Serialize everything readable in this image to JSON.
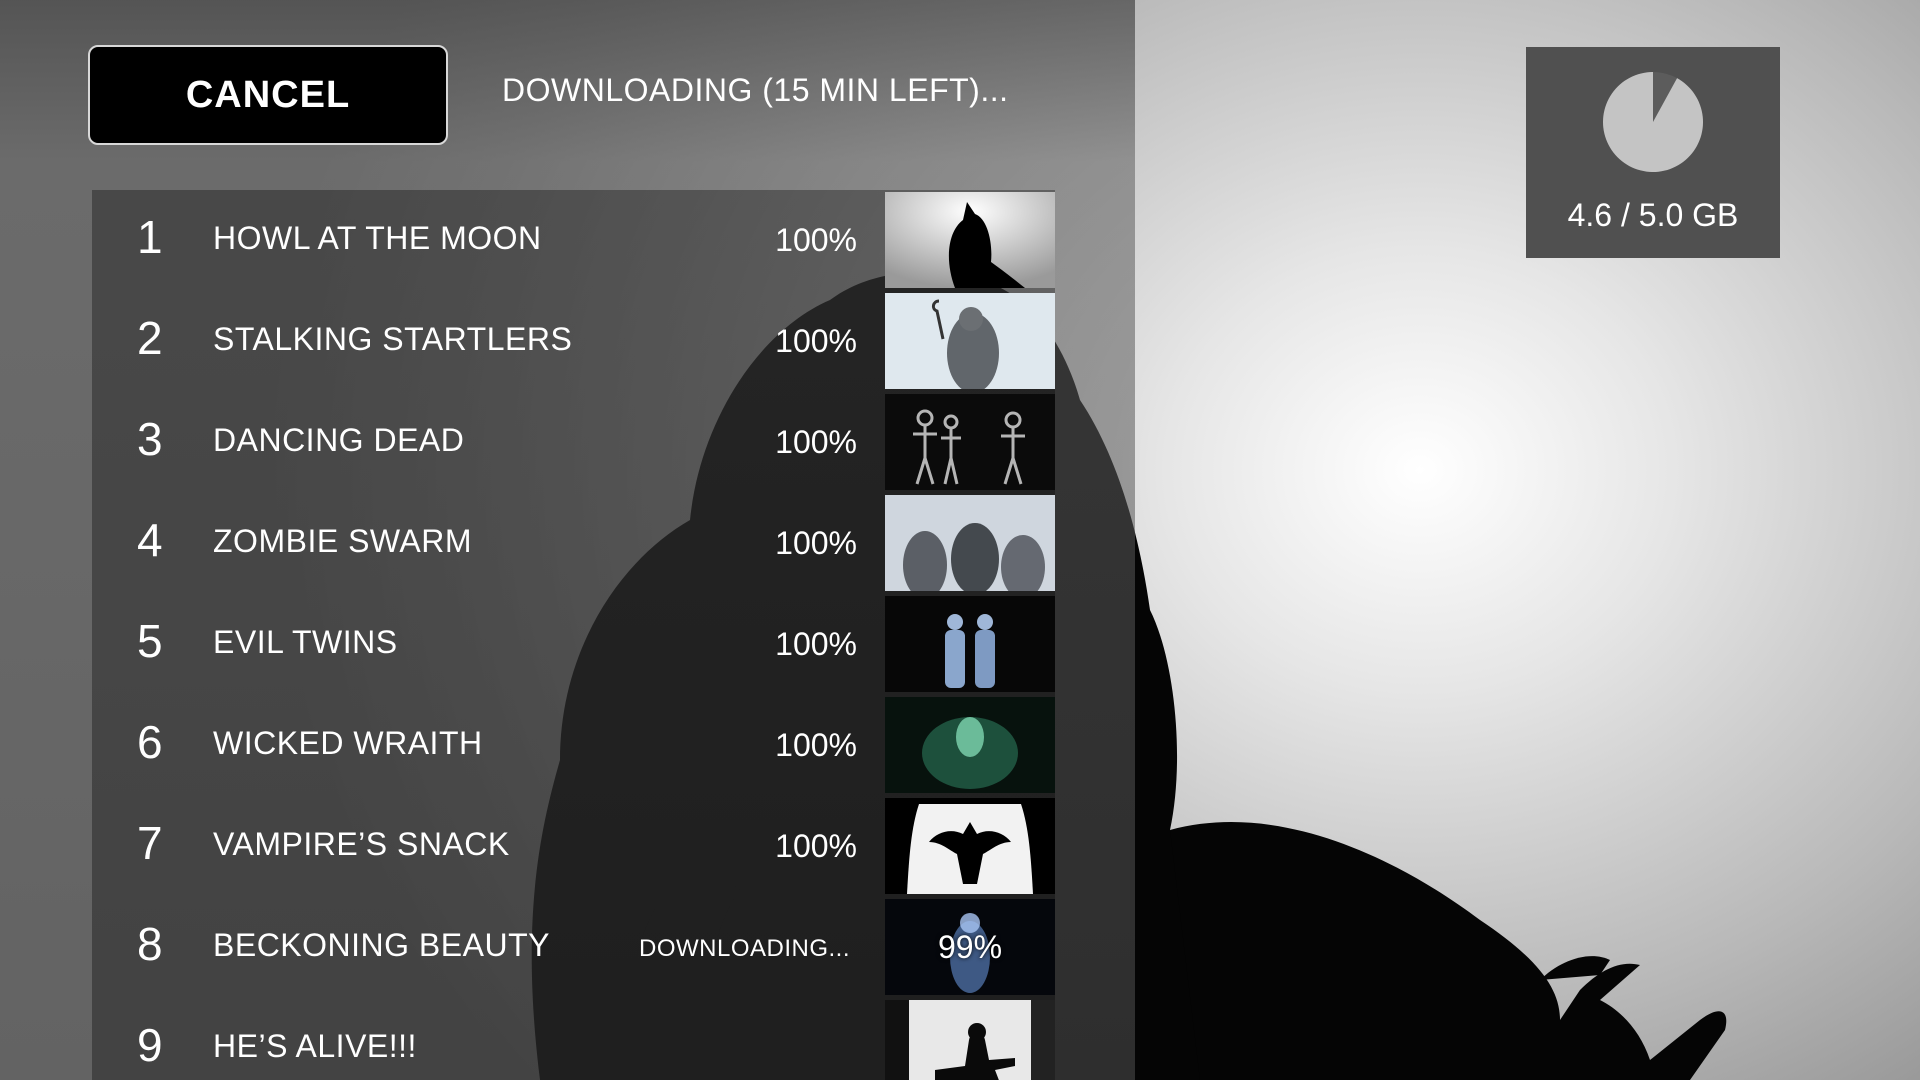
{
  "header": {
    "cancel_label": "CANCEL",
    "status": "DOWNLOADING (15 MIN LEFT)..."
  },
  "storage": {
    "label": "4.6 / 5.0 GB",
    "used_gb": 4.6,
    "total_gb": 5.0,
    "icon": "pie-chart-icon"
  },
  "downloads": [
    {
      "num": "1",
      "title": "HOWL AT THE MOON",
      "percent": "100%",
      "thumb": "werewolf-thumbnail"
    },
    {
      "num": "2",
      "title": "STALKING STARTLERS",
      "percent": "100%",
      "thumb": "hook-man-thumbnail"
    },
    {
      "num": "3",
      "title": "DANCING DEAD",
      "percent": "100%",
      "thumb": "skeletons-thumbnail"
    },
    {
      "num": "4",
      "title": "ZOMBIE SWARM",
      "percent": "100%",
      "thumb": "zombies-thumbnail"
    },
    {
      "num": "5",
      "title": "EVIL TWINS",
      "percent": "100%",
      "thumb": "twins-thumbnail"
    },
    {
      "num": "6",
      "title": "WICKED WRAITH",
      "percent": "100%",
      "thumb": "wraith-thumbnail"
    },
    {
      "num": "7",
      "title": "VAMPIRE’S SNACK",
      "percent": "100%",
      "thumb": "bat-thumbnail"
    },
    {
      "num": "8",
      "title": "BECKONING BEAUTY",
      "state": "DOWNLOADING...",
      "thumb_percent": "99%",
      "thumb": "ghost-lady-thumbnail"
    },
    {
      "num": "9",
      "title": "HE’S ALIVE!!!",
      "thumb": "laboratory-thumbnail"
    }
  ],
  "colors": {
    "panel": "#4a4a4a",
    "button_bg": "#000000",
    "text": "#ffffff",
    "wraith_green": "#3fa07a",
    "ghost_blue": "#7fb0ff"
  }
}
